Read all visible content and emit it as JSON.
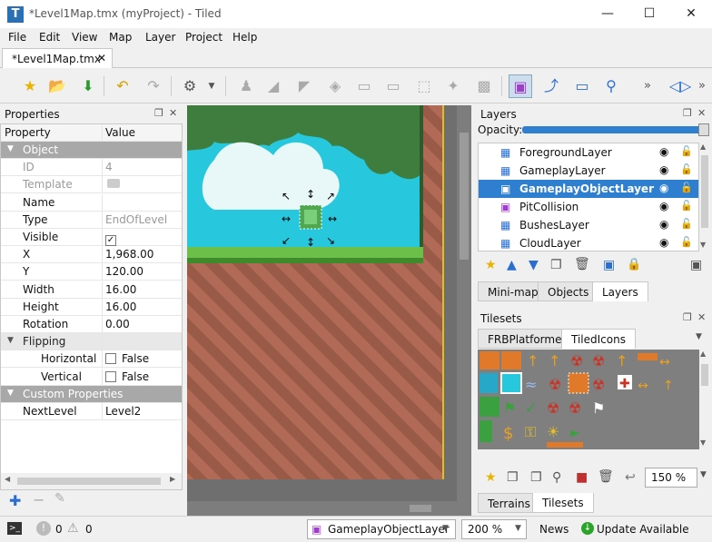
{
  "window": {
    "title": "*Level1Map.tmx (myProject) - Tiled",
    "logo_letter": "T"
  },
  "menu": [
    "File",
    "Edit",
    "View",
    "Map",
    "Layer",
    "Project",
    "Help"
  ],
  "document_tab": {
    "label": "*Level1Map.tmx",
    "close": "✕"
  },
  "properties": {
    "title": "Properties",
    "col_property": "Property",
    "col_value": "Value",
    "rows": [
      {
        "key": "Object",
        "value": "",
        "group": true
      },
      {
        "key": "ID",
        "value": "4",
        "dim": true
      },
      {
        "key": "Template",
        "value": "",
        "dim": true
      },
      {
        "key": "Name",
        "value": ""
      },
      {
        "key": "Type",
        "value": "EndOfLevel",
        "dimv": true
      },
      {
        "key": "Visible",
        "value": "✓",
        "check": true
      },
      {
        "key": "X",
        "value": "1,968.00"
      },
      {
        "key": "Y",
        "value": "120.00"
      },
      {
        "key": "Width",
        "value": "16.00"
      },
      {
        "key": "Height",
        "value": "16.00"
      },
      {
        "key": "Rotation",
        "value": "0.00"
      },
      {
        "key": "Flipping",
        "value": "",
        "group2": true
      },
      {
        "key": "Horizontal",
        "value": "False",
        "indent": true,
        "check": true
      },
      {
        "key": "Vertical",
        "value": "False",
        "indent": true,
        "check": true
      },
      {
        "key": "Custom Properties",
        "value": "",
        "group": true
      },
      {
        "key": "NextLevel",
        "value": "Level2"
      }
    ]
  },
  "layers": {
    "title": "Layers",
    "opacity_label": "Opacity:",
    "items": [
      {
        "name": "ForegroundLayer",
        "type": "tile"
      },
      {
        "name": "GameplayLayer",
        "type": "tile"
      },
      {
        "name": "GameplayObjectLayer",
        "type": "object",
        "selected": true
      },
      {
        "name": "PitCollision",
        "type": "object"
      },
      {
        "name": "BushesLayer",
        "type": "tile"
      },
      {
        "name": "CloudLayer",
        "type": "tile"
      }
    ],
    "tabs": [
      "Mini-map",
      "Objects",
      "Layers"
    ]
  },
  "tilesets": {
    "title": "Tilesets",
    "tabs": [
      "FRBPlatformer",
      "TiledIcons"
    ],
    "zoom": "150 %",
    "bottom_tabs": [
      "Terrains",
      "Tilesets"
    ]
  },
  "status": {
    "errors": "0",
    "warnings": "0",
    "layer": "GameplayObjectLayer",
    "zoom": "200 %",
    "news": "News",
    "update": "Update Available"
  },
  "colors": {
    "accent": "#2f7fd0",
    "sky": "#27c7dd",
    "grass": "#3f7d3f",
    "dirt": "#b06a55",
    "update": "#2aa52a"
  }
}
